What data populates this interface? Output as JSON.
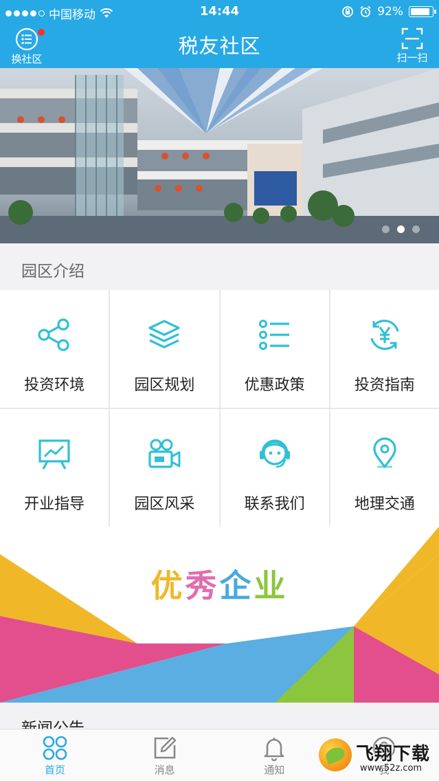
{
  "status_bar": {
    "carrier": "中国移动",
    "time": "14:44",
    "battery": "92%",
    "battery_level": 0.92
  },
  "header": {
    "title": "税友社区",
    "left_button_label": "换社区",
    "right_button_label": "扫一扫",
    "accent_color": "#27a9e5"
  },
  "banner": {
    "slide_count": 3,
    "active_slide": 2
  },
  "section": {
    "title": "园区介绍"
  },
  "grid_items": [
    {
      "label": "投资环境",
      "icon": "share-icon"
    },
    {
      "label": "园区规划",
      "icon": "layers-icon"
    },
    {
      "label": "优惠政策",
      "icon": "list-icon"
    },
    {
      "label": "投资指南",
      "icon": "yuan-exchange-icon"
    },
    {
      "label": "开业指导",
      "icon": "presentation-chart-icon"
    },
    {
      "label": "园区风采",
      "icon": "video-camera-icon"
    },
    {
      "label": "联系我们",
      "icon": "customer-service-icon"
    },
    {
      "label": "地理交通",
      "icon": "location-pin-icon"
    }
  ],
  "promo": {
    "title_chars": [
      "优",
      "秀",
      "企",
      "业"
    ]
  },
  "news": {
    "title": "新闻公告"
  },
  "tabbar": {
    "tabs": [
      {
        "label": "首页",
        "icon": "home-grid-icon",
        "active": true
      },
      {
        "label": "消息",
        "icon": "edit-message-icon",
        "active": false
      },
      {
        "label": "通知",
        "icon": "bell-icon",
        "active": false
      },
      {
        "label": "我",
        "icon": "user-icon",
        "active": false
      }
    ]
  },
  "watermark": {
    "brand": "飞翔下载",
    "url": "www.52z.com"
  }
}
